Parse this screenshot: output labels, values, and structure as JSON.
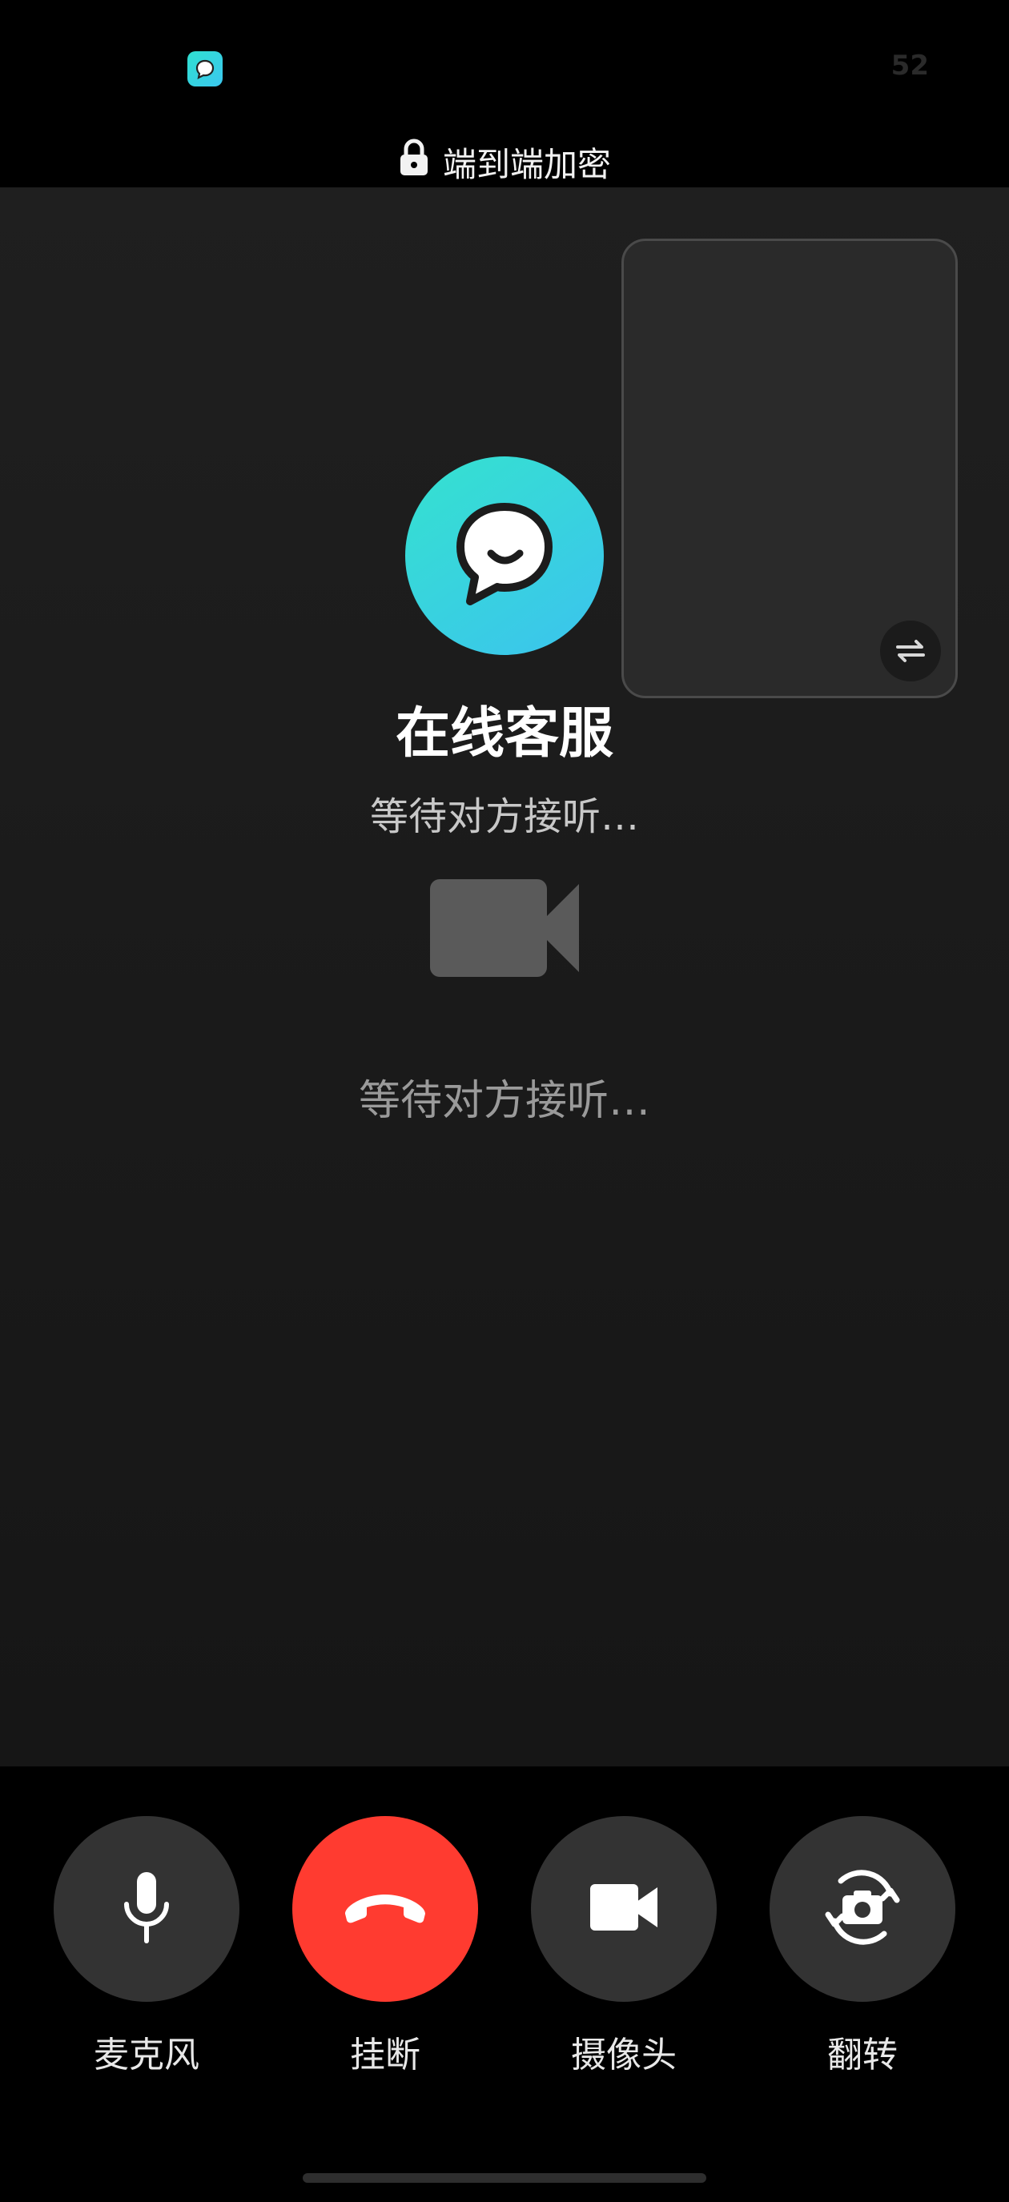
{
  "status_bar": {
    "number": "52",
    "app_icon": "chat-bubble-icon"
  },
  "encryption": {
    "label": "端到端加密",
    "icon": "lock-icon"
  },
  "contact": {
    "name": "在线客服",
    "status": "等待对方接听…",
    "avatar_icon": "chat-bubble-smile-icon"
  },
  "video_placeholder": {
    "icon": "video-camera-icon",
    "status": "等待对方接听…"
  },
  "pip": {
    "switch_icon": "swap-arrows-icon"
  },
  "controls": [
    {
      "label": "麦克风",
      "icon": "microphone-icon"
    },
    {
      "label": "挂断",
      "icon": "hang-up-icon",
      "color": "#ff3b30"
    },
    {
      "label": "摄像头",
      "icon": "video-camera-icon"
    },
    {
      "label": "翻转",
      "icon": "flip-camera-icon"
    }
  ],
  "colors": {
    "accent": "#3bc7ef",
    "hangup": "#ff3b30",
    "button": "#333333"
  }
}
